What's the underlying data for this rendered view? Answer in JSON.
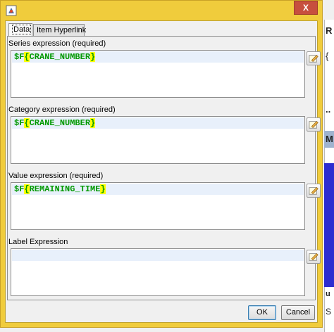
{
  "background": {
    "fragments": [
      "R",
      "{",
      "..",
      "M",
      "u",
      "S"
    ]
  },
  "dialog": {
    "close_symbol": "X",
    "tabs": [
      {
        "label": "Data",
        "selected": true
      },
      {
        "label": "Item Hyperlink",
        "selected": false
      }
    ],
    "fields": [
      {
        "label": "Series expression (required)",
        "prefix": "$F",
        "open": "{",
        "name": "CRANE_NUMBER",
        "close": "}"
      },
      {
        "label": "Category expression (required)",
        "prefix": "$F",
        "open": "{",
        "name": "CRANE_NUMBER",
        "close": "}"
      },
      {
        "label": "Value expression (required)",
        "prefix": "$F",
        "open": "{",
        "name": "REMAINING_TIME",
        "close": "}"
      },
      {
        "label": "Label Expression",
        "prefix": "",
        "open": "",
        "name": "",
        "close": ""
      }
    ],
    "buttons": {
      "ok": "OK",
      "cancel": "Cancel"
    }
  },
  "colors": {
    "title_bar": "#f0cc3c",
    "close_button": "#c74f3e",
    "expression_text": "#009900",
    "brace_highlight": "#ffff00",
    "current_line": "#e8f0fb"
  }
}
